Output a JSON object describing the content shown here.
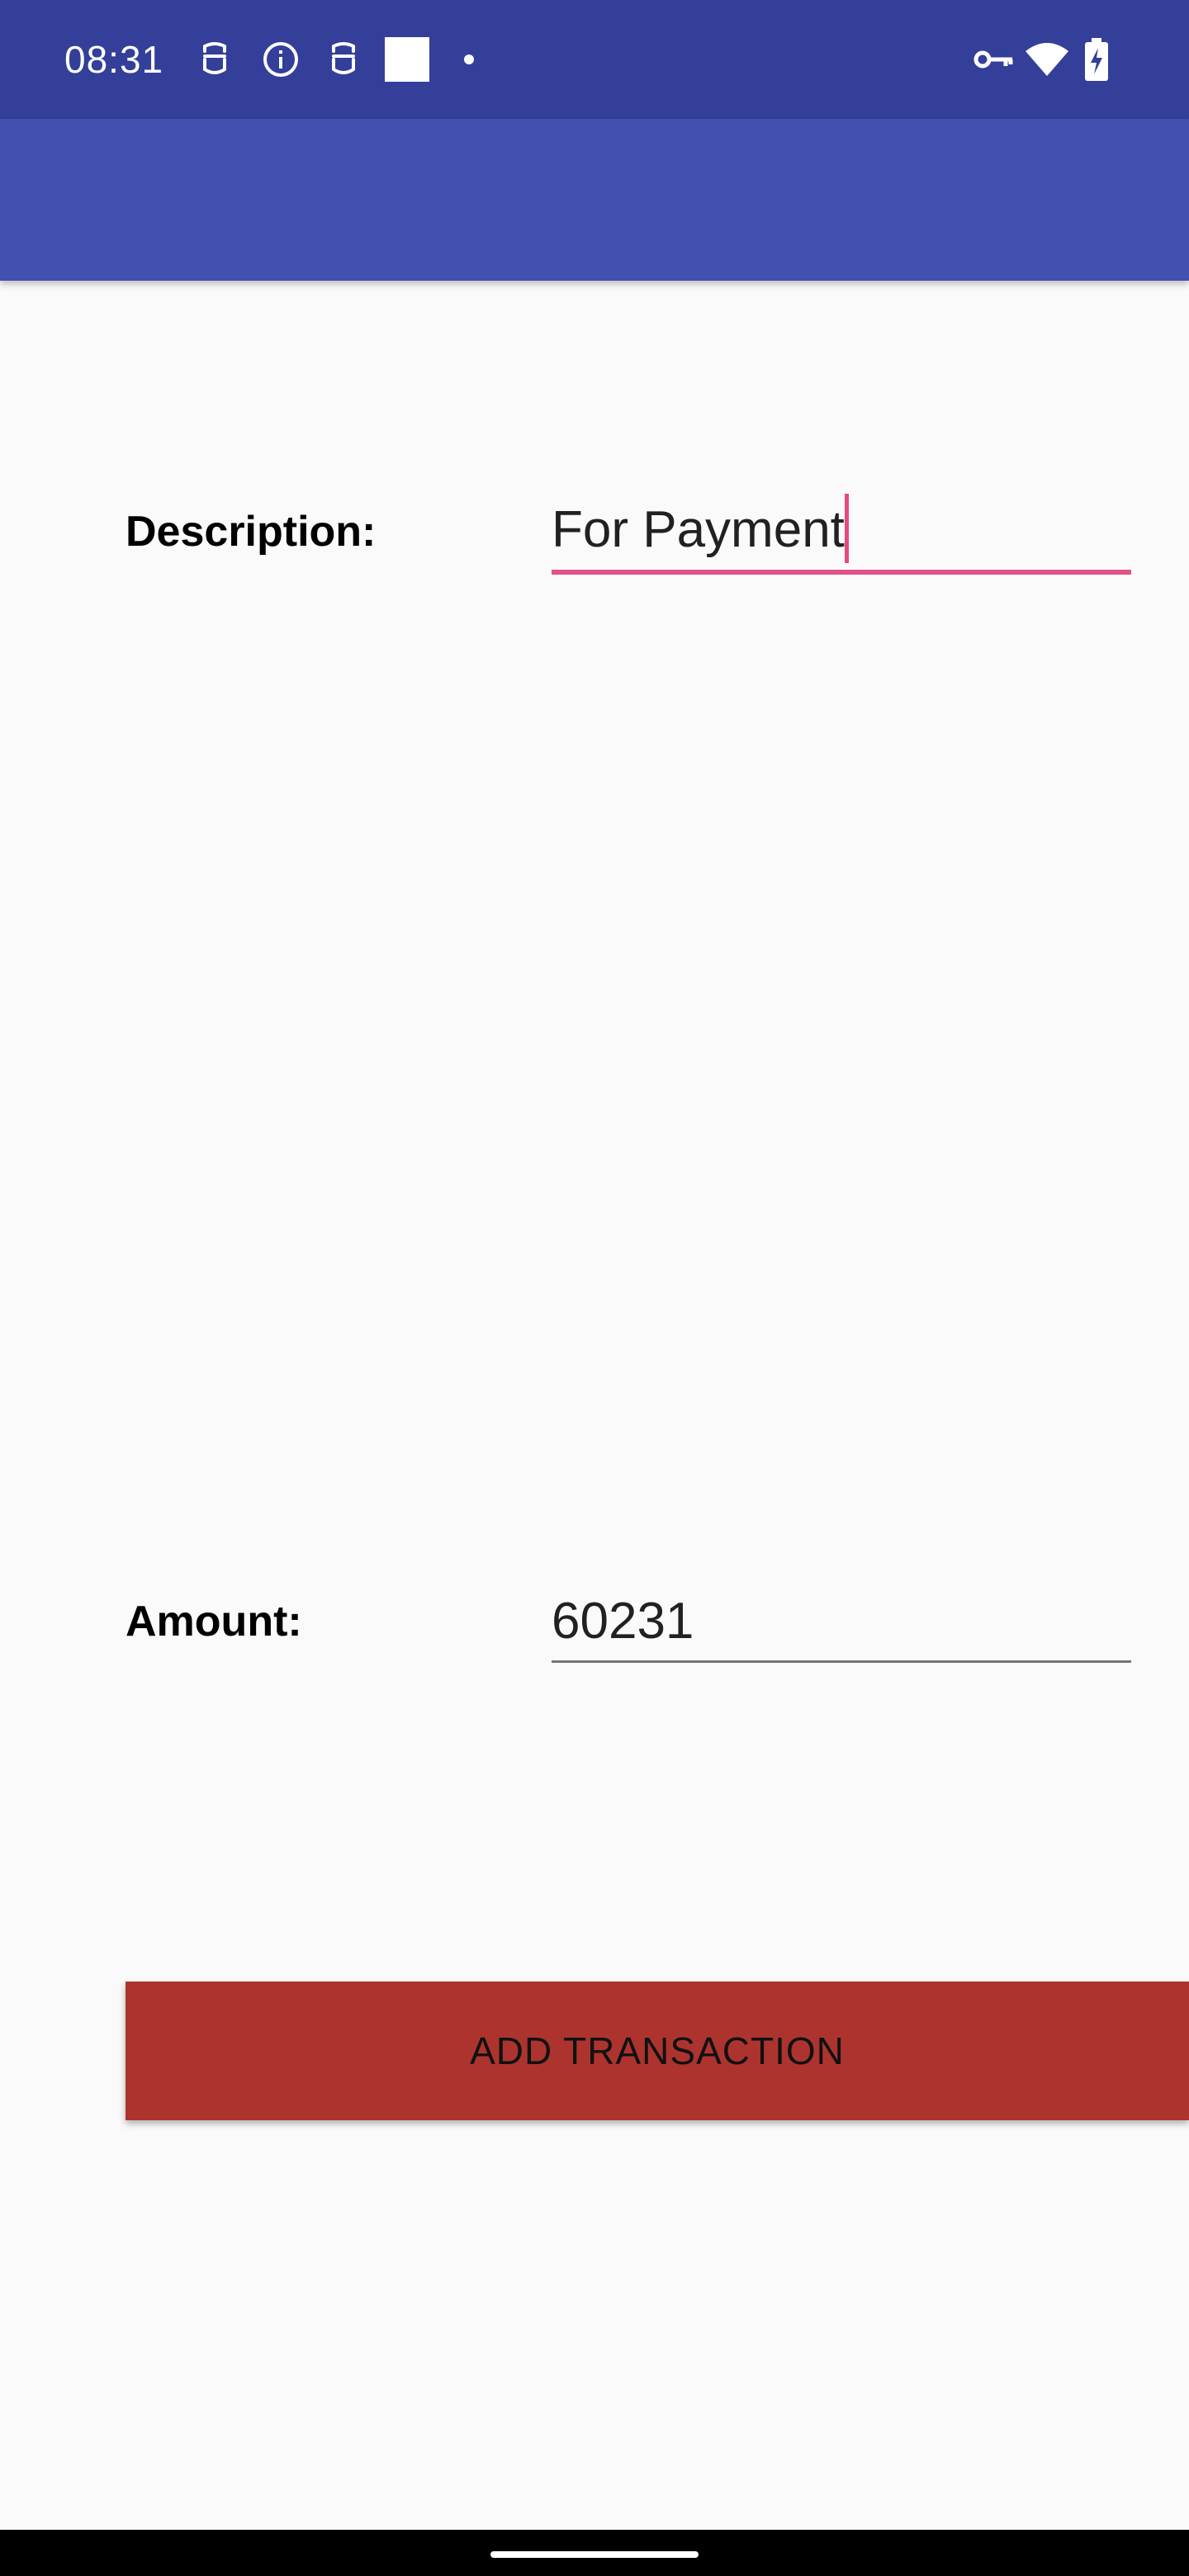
{
  "status_bar": {
    "time": "08:31",
    "left_icons": [
      "notification-app-icon",
      "info-icon",
      "notification-app-icon",
      "square-notification-icon",
      "dot-icon"
    ],
    "right_icons": [
      "vpn-key-icon",
      "wifi-icon",
      "battery-charging-icon"
    ],
    "background_color": "#333f99"
  },
  "app_bar": {
    "title": "",
    "background_color": "#4450b0"
  },
  "form": {
    "description": {
      "label": "Description:",
      "value": "For Payment",
      "focused": true,
      "accent_color": "#e05386"
    },
    "amount": {
      "label": "Amount:",
      "value": "60231"
    },
    "submit_label": "ADD TRANSACTION",
    "submit_color": "#ad342e"
  }
}
